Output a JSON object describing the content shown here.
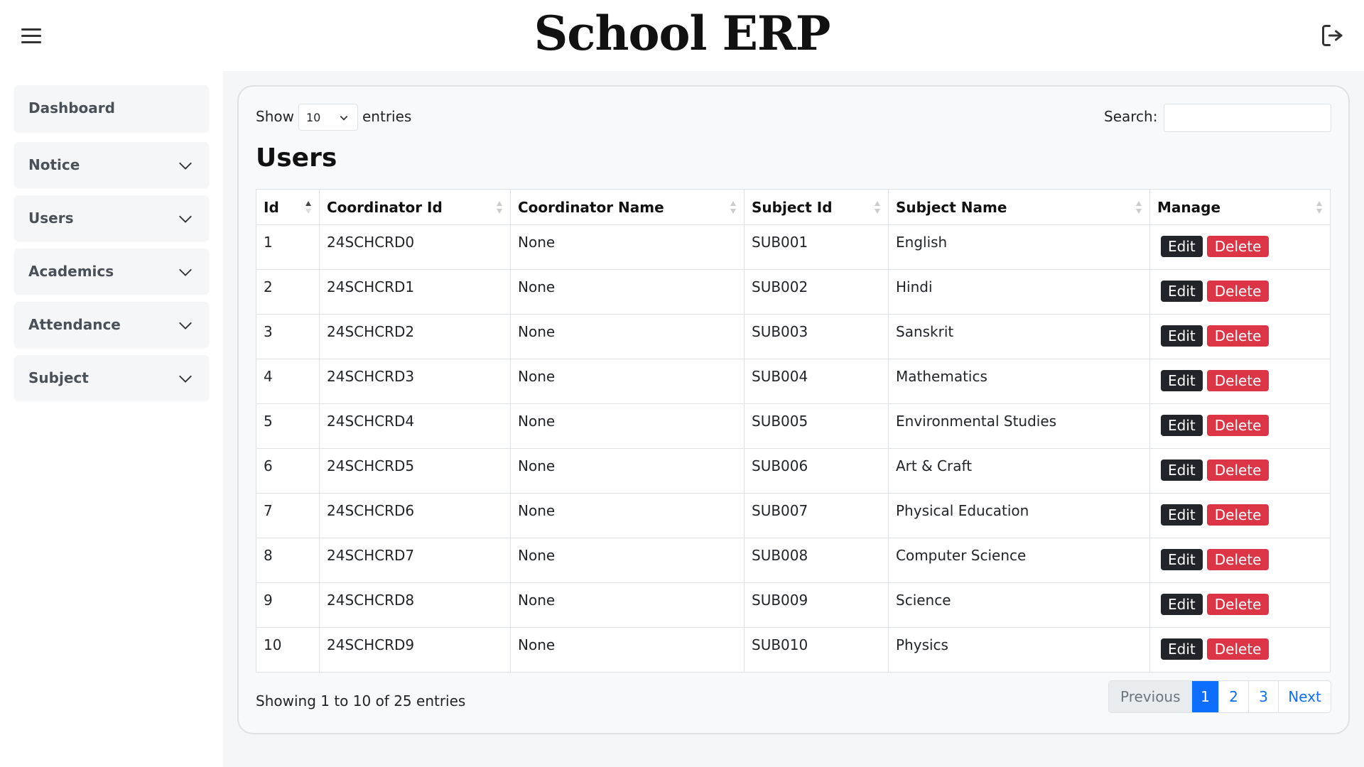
{
  "header": {
    "title": "School ERP",
    "menu_icon": "hamburger-icon",
    "logout_icon": "logout-icon"
  },
  "sidebar": {
    "items": [
      {
        "label": "Dashboard",
        "has_submenu": false
      },
      {
        "label": "Notice",
        "has_submenu": true
      },
      {
        "label": "Users",
        "has_submenu": true
      },
      {
        "label": "Academics",
        "has_submenu": true
      },
      {
        "label": "Attendance",
        "has_submenu": true
      },
      {
        "label": "Subject",
        "has_submenu": true
      }
    ]
  },
  "controls": {
    "show_label": "Show",
    "page_size": "10",
    "entries_label": "entries",
    "search_label": "Search:",
    "search_value": ""
  },
  "page": {
    "heading": "Users"
  },
  "table": {
    "columns": [
      "Id",
      "Coordinator Id",
      "Coordinator Name",
      "Subject Id",
      "Subject Name",
      "Manage"
    ],
    "rows": [
      [
        "1",
        "24SCHCRD0",
        "None",
        "SUB001",
        "English"
      ],
      [
        "2",
        "24SCHCRD1",
        "None",
        "SUB002",
        "Hindi"
      ],
      [
        "3",
        "24SCHCRD2",
        "None",
        "SUB003",
        "Sanskrit"
      ],
      [
        "4",
        "24SCHCRD3",
        "None",
        "SUB004",
        "Mathematics"
      ],
      [
        "5",
        "24SCHCRD4",
        "None",
        "SUB005",
        "Environmental Studies"
      ],
      [
        "6",
        "24SCHCRD5",
        "None",
        "SUB006",
        "Art & Craft"
      ],
      [
        "7",
        "24SCHCRD6",
        "None",
        "SUB007",
        "Physical Education"
      ],
      [
        "8",
        "24SCHCRD7",
        "None",
        "SUB008",
        "Computer Science"
      ],
      [
        "9",
        "24SCHCRD8",
        "None",
        "SUB009",
        "Science"
      ],
      [
        "10",
        "24SCHCRD9",
        "None",
        "SUB010",
        "Physics"
      ]
    ],
    "edit_label": "Edit",
    "delete_label": "Delete"
  },
  "footer": {
    "info": "Showing 1 to 10 of 25 entries",
    "pagination": {
      "previous": "Previous",
      "pages": [
        "1",
        "2",
        "3"
      ],
      "current": "1",
      "next": "Next"
    }
  },
  "colors": {
    "accent": "#0d6efd",
    "danger": "#dc3545",
    "dark": "#212529"
  }
}
